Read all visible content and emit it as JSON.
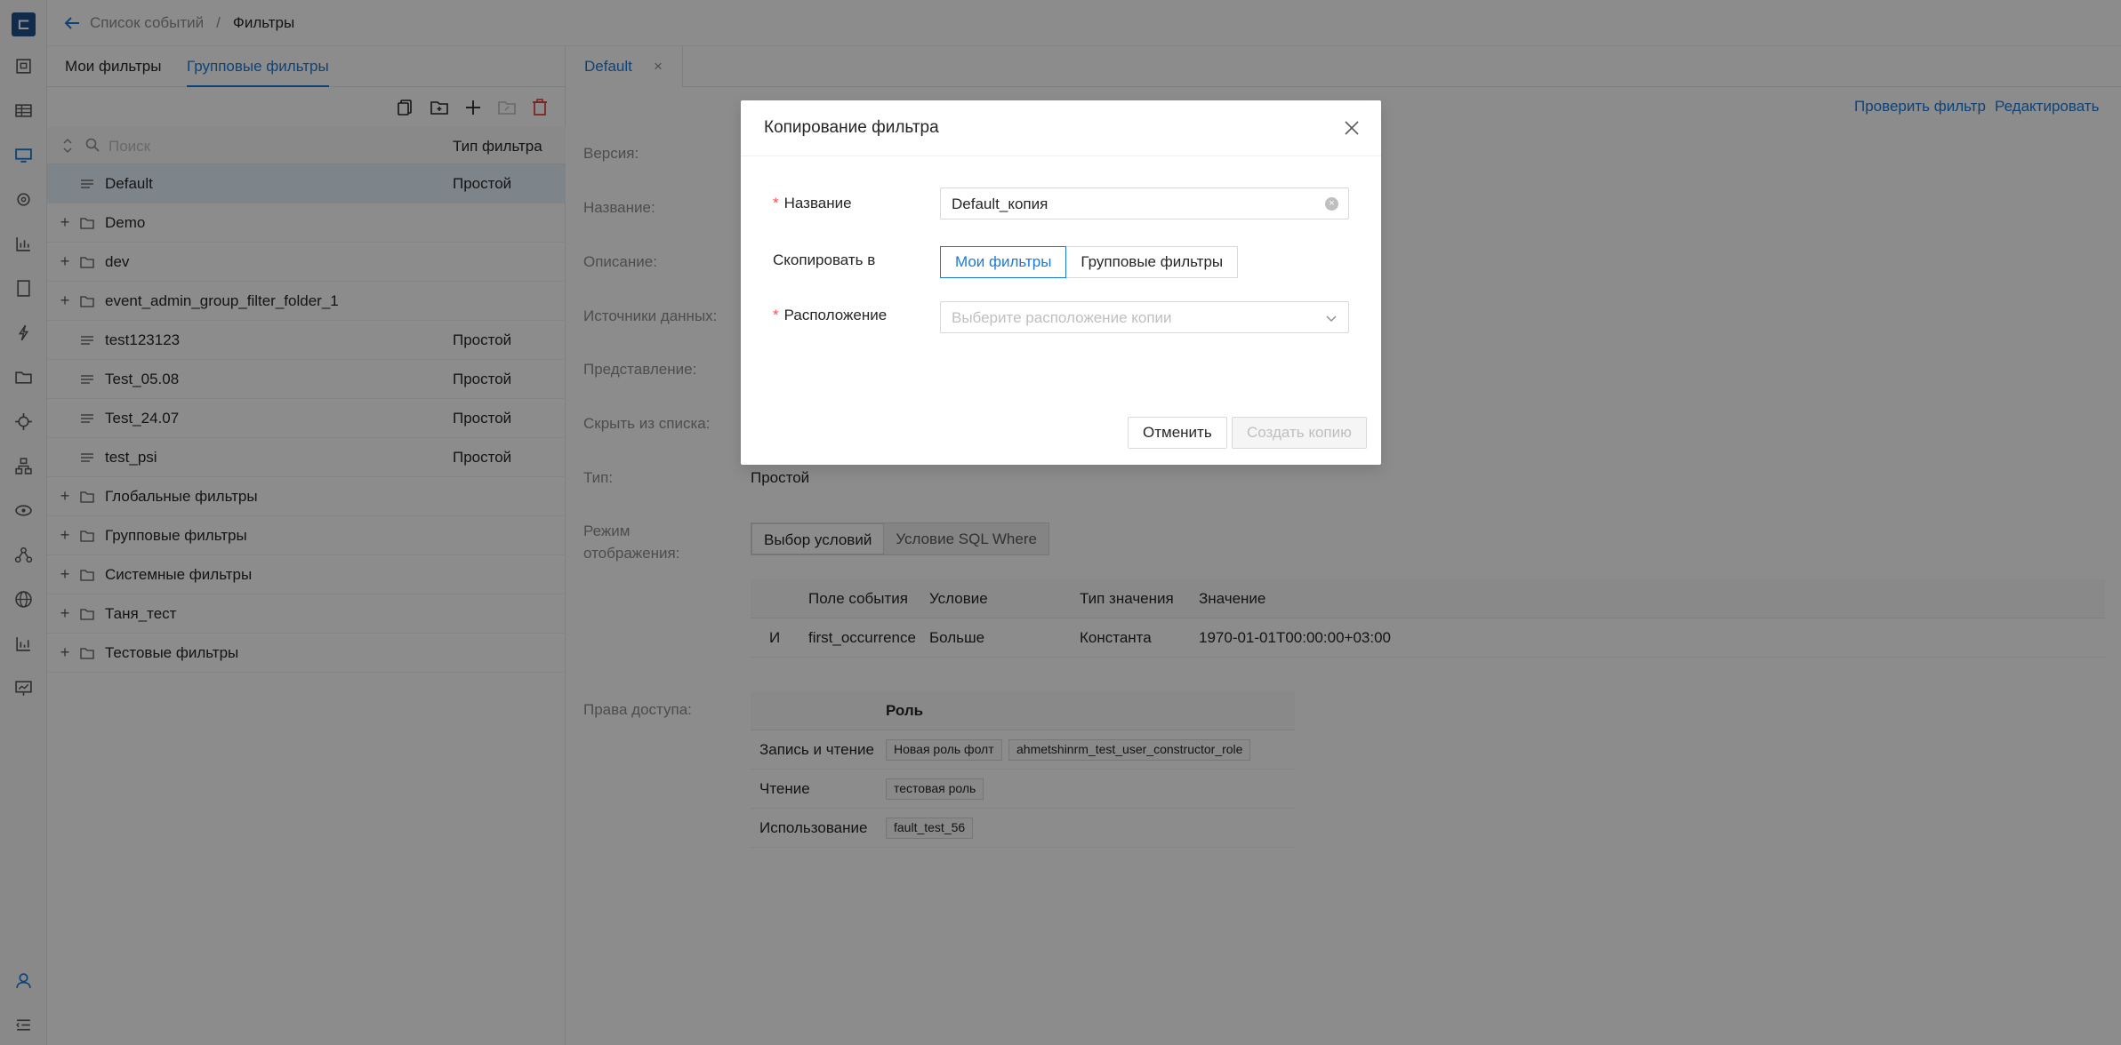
{
  "breadcrumb": {
    "parent": "Список событий",
    "separator": "/",
    "current": "Фильтры"
  },
  "left_tabs": {
    "my": "Мои фильтры",
    "group": "Групповые фильтры"
  },
  "tree": {
    "search_placeholder": "Поиск",
    "type_header": "Тип фильтра",
    "rows": [
      {
        "kind": "filter",
        "name": "Default",
        "type": "Простой",
        "selected": true
      },
      {
        "kind": "folder",
        "name": "Demo",
        "type": ""
      },
      {
        "kind": "folder",
        "name": "dev",
        "type": ""
      },
      {
        "kind": "folder",
        "name": "event_admin_group_filter_folder_1",
        "type": ""
      },
      {
        "kind": "filter",
        "name": "test123123",
        "type": "Простой"
      },
      {
        "kind": "filter",
        "name": "Test_05.08",
        "type": "Простой"
      },
      {
        "kind": "filter",
        "name": "Test_24.07",
        "type": "Простой"
      },
      {
        "kind": "filter",
        "name": "test_psi",
        "type": "Простой"
      },
      {
        "kind": "folder",
        "name": "Глобальные фильтры",
        "type": ""
      },
      {
        "kind": "folder",
        "name": "Групповые фильтры",
        "type": ""
      },
      {
        "kind": "folder",
        "name": "Системные фильтры",
        "type": ""
      },
      {
        "kind": "folder",
        "name": "Таня_тест",
        "type": ""
      },
      {
        "kind": "folder",
        "name": "Тестовые фильтры",
        "type": ""
      }
    ]
  },
  "editor": {
    "tab_label": "Default",
    "tab_close": "×",
    "check_label": "Проверить фильтр",
    "edit_label": "Редактировать",
    "labels": {
      "version": "Версия:",
      "name": "Название:",
      "description": "Описание:",
      "sources": "Источники данных:",
      "view": "Представление:",
      "hide": "Скрыть из списка:",
      "type": "Тип:",
      "mode_line1": "Режим",
      "mode_line2": "отображения:",
      "access": "Права доступа:"
    },
    "type_value": "Простой",
    "mode_options": [
      "Выбор условий",
      "Условие SQL Where"
    ],
    "conditions": {
      "headers": [
        "Поле события",
        "Условие",
        "Тип значения",
        "Значение"
      ],
      "rows": [
        {
          "op": "И",
          "field": "first_occurrence",
          "cond": "Больше",
          "vtype": "Константа",
          "value": "1970-01-01T00:00:00+03:00"
        }
      ]
    },
    "access": {
      "header": "Роль",
      "rows": [
        {
          "name": "Запись и чтение",
          "roles": [
            "Новая роль фолт",
            "ahmetshinrm_test_user_constructor_role"
          ]
        },
        {
          "name": "Чтение",
          "roles": [
            "тестовая роль"
          ]
        },
        {
          "name": "Использование",
          "roles": [
            "fault_test_56"
          ]
        }
      ]
    }
  },
  "modal": {
    "title": "Копирование фильтра",
    "name_label": "Название",
    "name_value": "Default_копия",
    "copy_to_label": "Скопировать в",
    "copy_to_options": [
      "Мои фильтры",
      "Групповые фильтры"
    ],
    "location_label": "Расположение",
    "location_placeholder": "Выберите расположение копии",
    "cancel_label": "Отменить",
    "create_label": "Создать копию"
  },
  "colors": {
    "accent": "#1a7ad9",
    "required": "#ff4d4f",
    "mask": "rgba(0,0,0,0.45)"
  }
}
